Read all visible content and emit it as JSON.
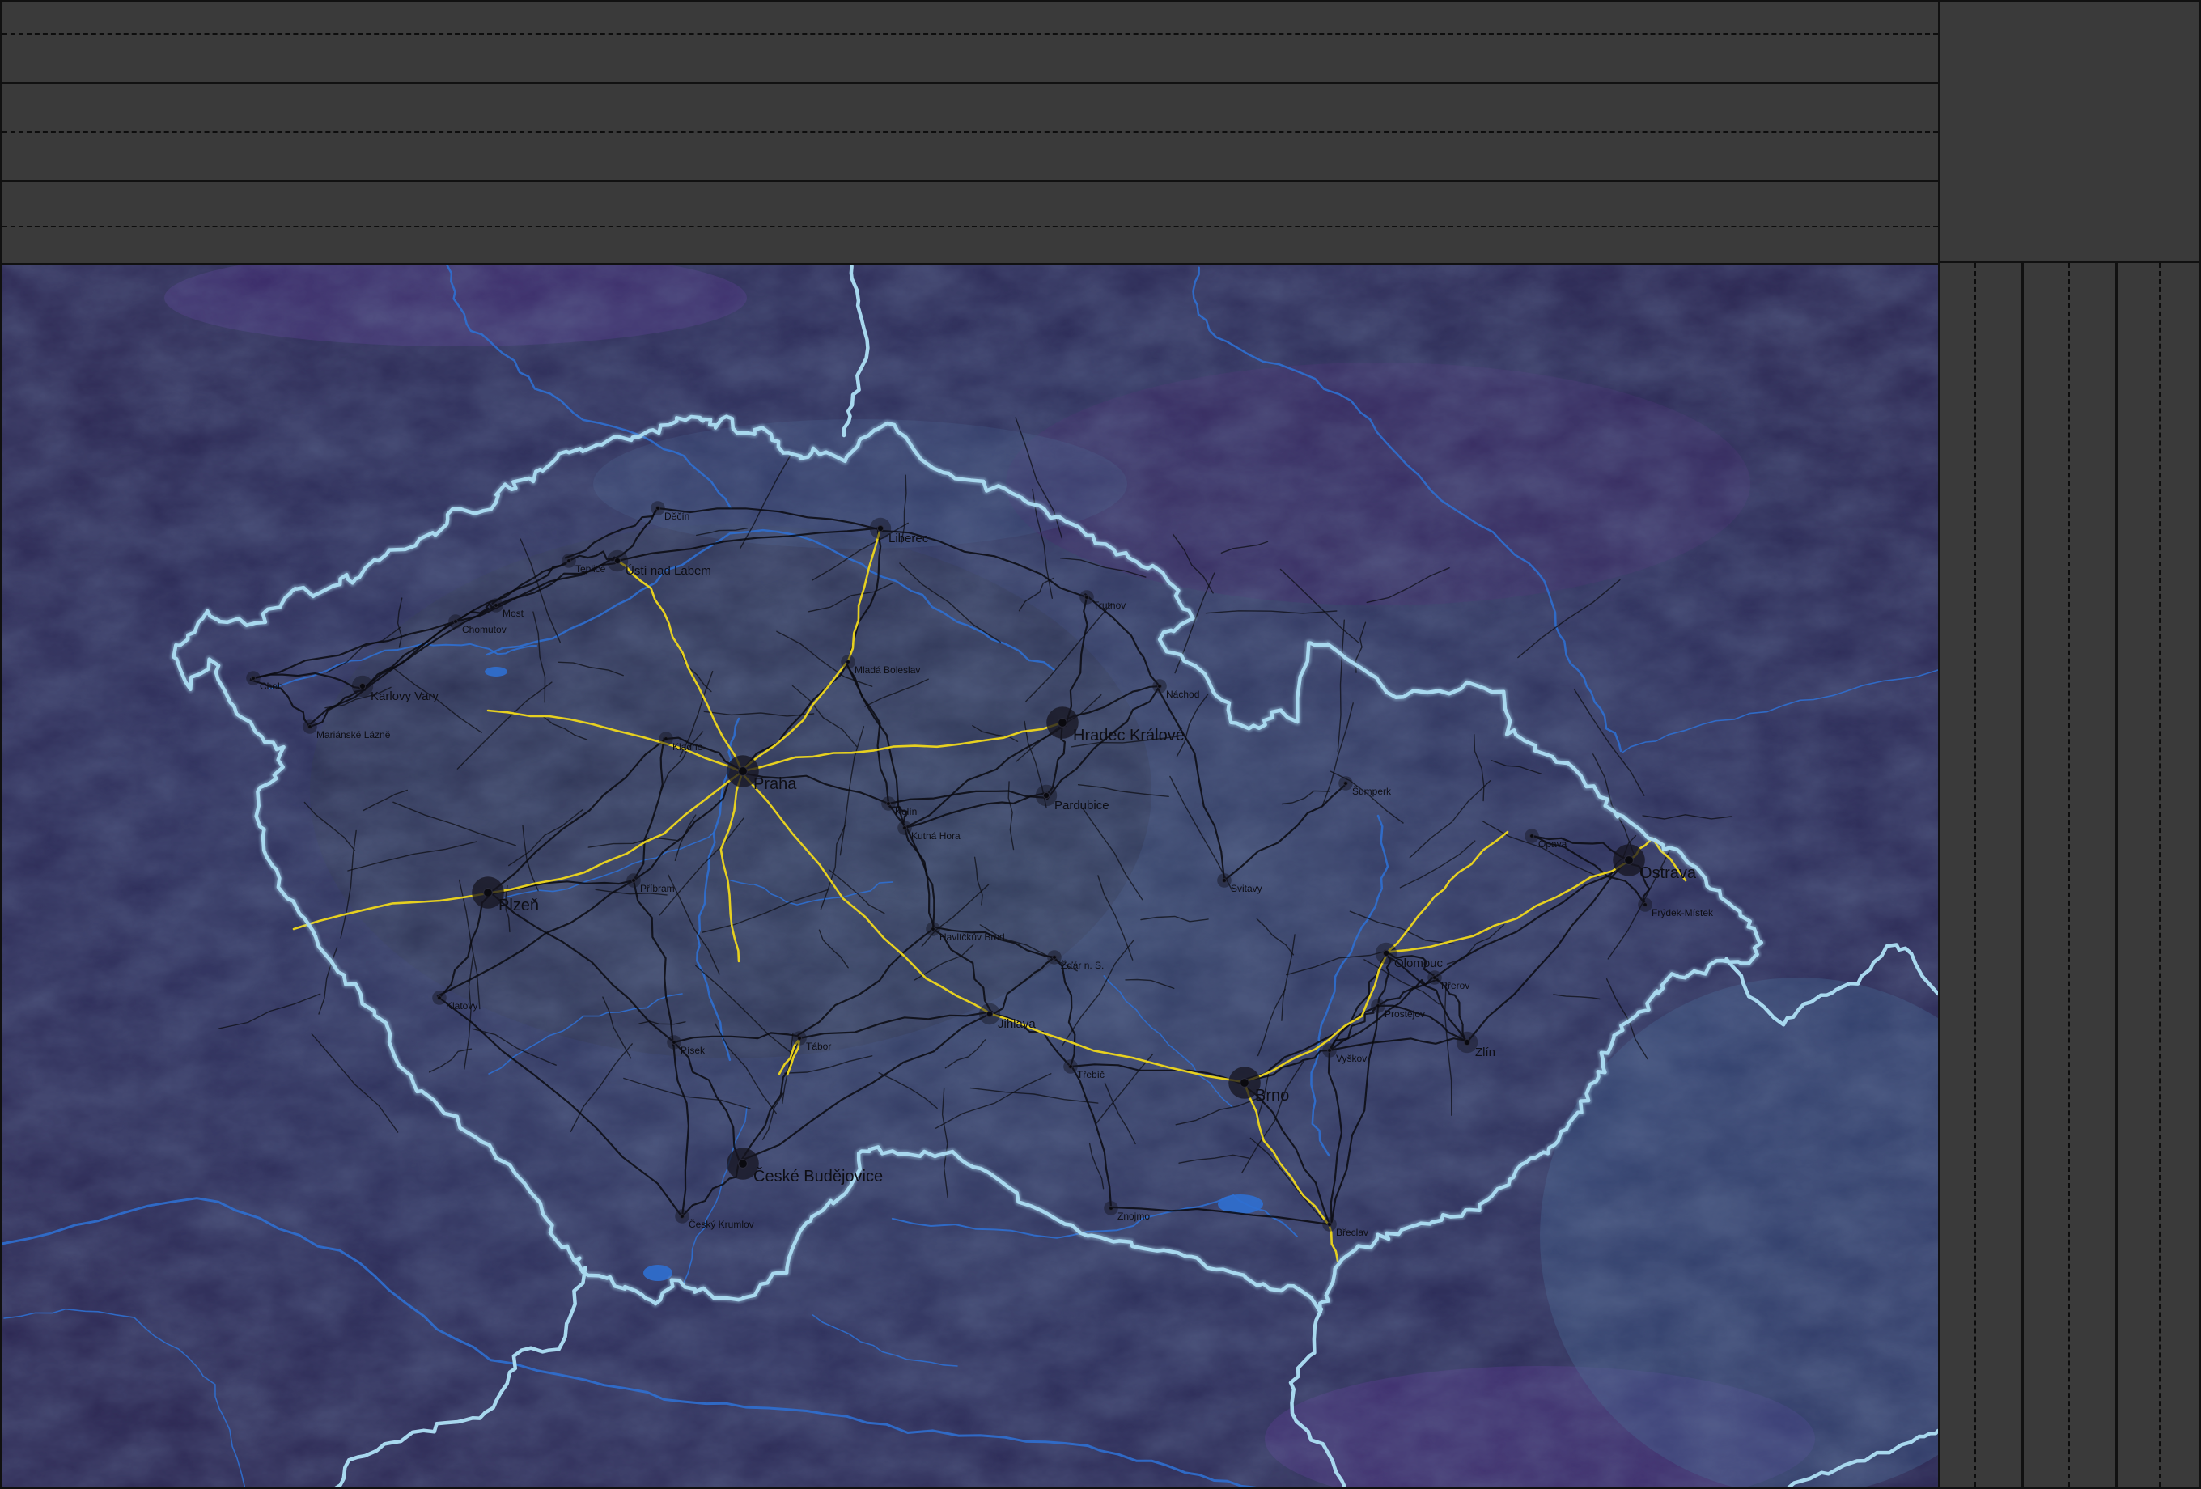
{
  "top_bands": [
    {
      "label": ""
    },
    {
      "label": ""
    },
    {
      "label": ""
    }
  ],
  "map": {
    "background_color": "#2e2a55",
    "border_color": "#a8d8ee",
    "river_color": "#2f6fd0",
    "road_color": "#0b0b10",
    "highway_color": "#e6d020",
    "cities": [
      {
        "name": "Praha",
        "size": "large"
      },
      {
        "name": "Brno",
        "size": "large"
      },
      {
        "name": "Ostrava",
        "size": "large"
      },
      {
        "name": "Plzeň",
        "size": "large"
      },
      {
        "name": "Hradec Králové",
        "size": "large"
      },
      {
        "name": "České Budějovice",
        "size": "large"
      },
      {
        "name": "Liberec",
        "size": "medium"
      },
      {
        "name": "Olomouc",
        "size": "medium"
      },
      {
        "name": "Zlín",
        "size": "medium"
      },
      {
        "name": "Pardubice",
        "size": "medium"
      },
      {
        "name": "Jihlava",
        "size": "medium"
      },
      {
        "name": "Karlovy Vary",
        "size": "medium"
      },
      {
        "name": "Ústí nad Labem",
        "size": "medium"
      },
      {
        "name": "Mladá Boleslav",
        "size": "small"
      },
      {
        "name": "Kladno",
        "size": "small"
      },
      {
        "name": "Tábor",
        "size": "small"
      },
      {
        "name": "Písek",
        "size": "small"
      },
      {
        "name": "Český Krumlov",
        "size": "small"
      },
      {
        "name": "Havlíčkův Brod",
        "size": "small"
      },
      {
        "name": "Kolín",
        "size": "small"
      },
      {
        "name": "Kutná Hora",
        "size": "small"
      },
      {
        "name": "Žďár n. S.",
        "size": "small"
      },
      {
        "name": "Třebíč",
        "size": "small"
      },
      {
        "name": "Znojmo",
        "size": "small"
      },
      {
        "name": "Břeclav",
        "size": "small"
      },
      {
        "name": "Přerov",
        "size": "small"
      },
      {
        "name": "Opava",
        "size": "small"
      },
      {
        "name": "Frýdek-Místek",
        "size": "small"
      },
      {
        "name": "Most",
        "size": "small"
      },
      {
        "name": "Teplice",
        "size": "small"
      },
      {
        "name": "Děčín",
        "size": "small"
      },
      {
        "name": "Cheb",
        "size": "small"
      },
      {
        "name": "Mariánské Lázně",
        "size": "small"
      },
      {
        "name": "Klatovy",
        "size": "small"
      },
      {
        "name": "Příbram",
        "size": "small"
      },
      {
        "name": "Chomutov",
        "size": "small"
      },
      {
        "name": "Trutnov",
        "size": "small"
      },
      {
        "name": "Náchod",
        "size": "small"
      },
      {
        "name": "Šumperk",
        "size": "small"
      },
      {
        "name": "Svitavy",
        "size": "small"
      },
      {
        "name": "Vyškov",
        "size": "small"
      },
      {
        "name": "Prostějov",
        "size": "small"
      }
    ]
  }
}
